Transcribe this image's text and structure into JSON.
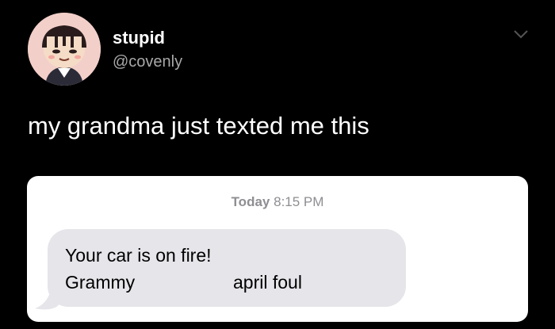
{
  "tweet": {
    "display_name": "stupid",
    "handle": "@covenly",
    "text": "my grandma just texted me this",
    "avatar_icon": "animal-crossing-villager-avatar",
    "menu_icon": "chevron-down-icon"
  },
  "screenshot": {
    "timestamp_day": "Today",
    "timestamp_time": "8:15 PM",
    "message_line1": "Your car is on fire!",
    "message_signature": "Grammy",
    "message_tail": "april foul",
    "bubble_color": "#e5e5ea"
  },
  "colors": {
    "background": "#000000",
    "primary_text": "#ffffff",
    "secondary_text": "#a8a8a8"
  }
}
